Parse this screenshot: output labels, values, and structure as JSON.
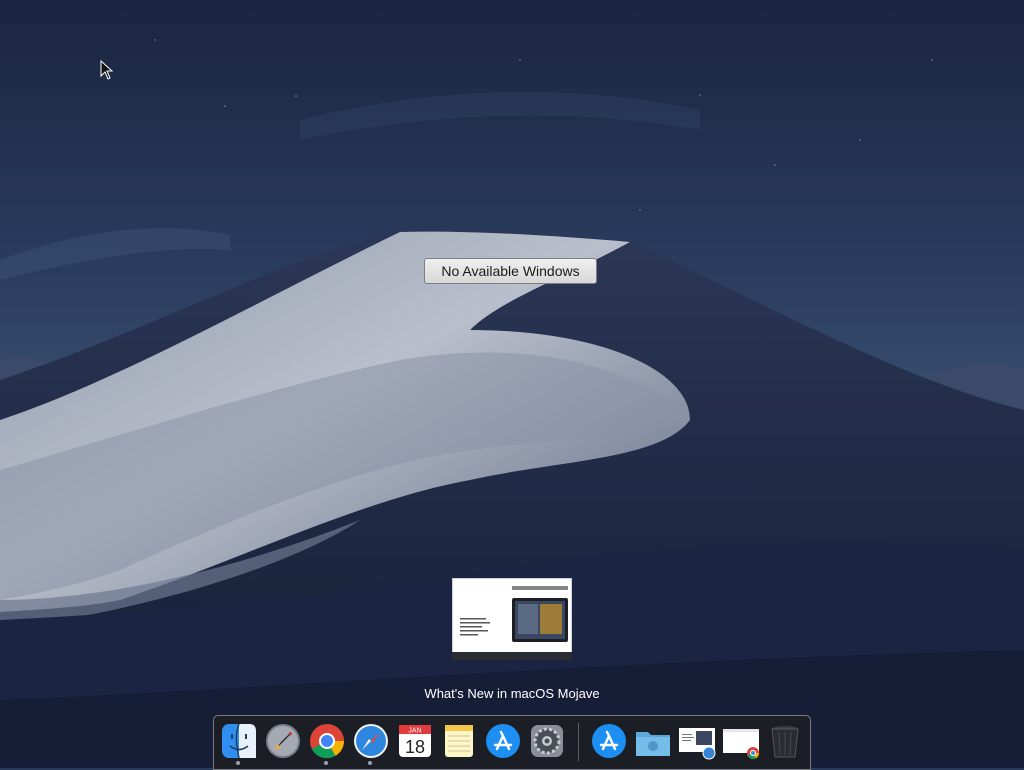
{
  "desktop": {
    "no_windows_label": "No Available Windows",
    "preview_caption": "What's New in macOS Mojave"
  },
  "dock": {
    "apps": [
      {
        "name": "Finder",
        "icon": "finder-icon",
        "running": true
      },
      {
        "name": "Launchpad",
        "icon": "launchpad-icon",
        "running": false
      },
      {
        "name": "Google Chrome",
        "icon": "chrome-icon",
        "running": true
      },
      {
        "name": "Safari",
        "icon": "safari-icon",
        "running": true
      },
      {
        "name": "Calendar",
        "icon": "calendar-icon",
        "running": false
      },
      {
        "name": "Notes",
        "icon": "notes-icon",
        "running": false
      },
      {
        "name": "App Store",
        "icon": "app-store-icon",
        "running": false
      },
      {
        "name": "System Preferences",
        "icon": "system-preferences-icon",
        "running": false
      }
    ],
    "calendar_month": "JAN",
    "calendar_day": "18",
    "stack_items": [
      {
        "icon": "downloads-app-store-icon"
      },
      {
        "icon": "documents-folder-icon"
      },
      {
        "icon": "minimized-safari-window-icon"
      },
      {
        "icon": "minimized-chrome-window-icon"
      },
      {
        "icon": "trash-icon"
      }
    ]
  },
  "colors": {
    "sky_top": "#1e2c4a",
    "sky_mid": "#2f4466",
    "dune_light": "#c9ced8",
    "dune_shadow": "#1b2543",
    "dock_bg": "#1c1e24"
  }
}
